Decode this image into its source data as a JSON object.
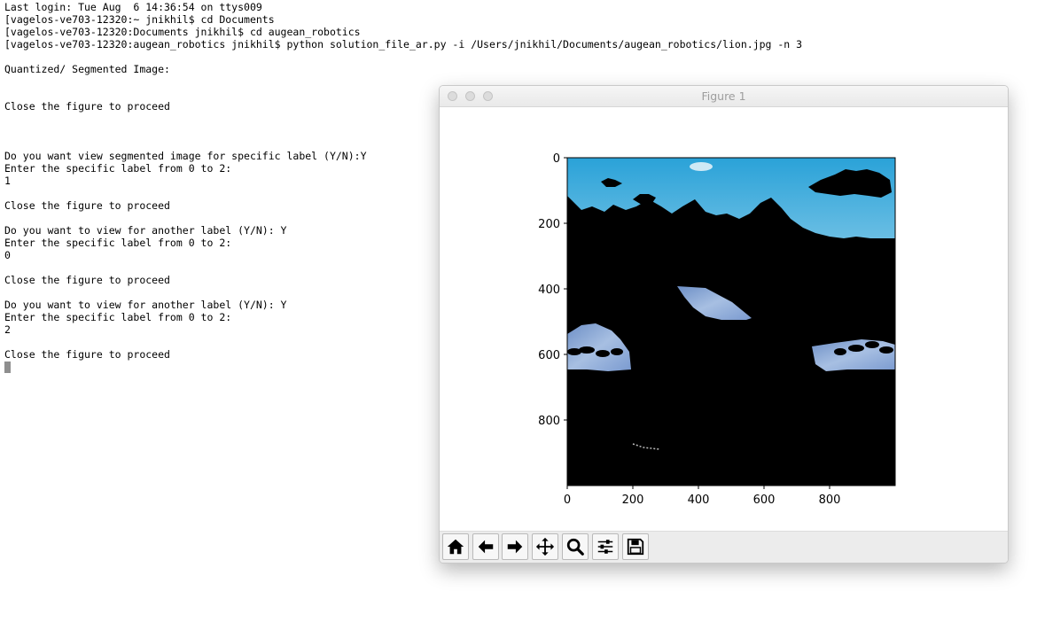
{
  "terminal": {
    "lines": [
      "Last login: Tue Aug  6 14:36:54 on ttys009",
      "[vagelos-ve703-12320:~ jnikhil$ cd Documents",
      "[vagelos-ve703-12320:Documents jnikhil$ cd augean_robotics",
      "[vagelos-ve703-12320:augean_robotics jnikhil$ python solution_file_ar.py -i /Users/jnikhil/Documents/augean_robotics/lion.jpg -n 3",
      "",
      "Quantized/ Segmented Image:",
      "",
      "",
      "Close the figure to proceed",
      "",
      "",
      "",
      "Do you want view segmented image for specific label (Y/N):Y",
      "Enter the specific label from 0 to 2:",
      "1",
      "",
      "Close the figure to proceed",
      "",
      "Do you want to view for another label (Y/N): Y",
      "Enter the specific label from 0 to 2:",
      "0",
      "",
      "Close the figure to proceed",
      "",
      "Do you want to view for another label (Y/N): Y",
      "Enter the specific label from 0 to 2:",
      "2",
      "",
      "Close the figure to proceed"
    ]
  },
  "figure": {
    "window_title": "Figure 1",
    "plot": {
      "x_ticks": [
        "0",
        "200",
        "400",
        "600",
        "800"
      ],
      "y_ticks": [
        "0",
        "200",
        "400",
        "600",
        "800"
      ],
      "xlim": [
        0,
        1000
      ],
      "ylim_inverted": [
        1000,
        0
      ],
      "image_description": "segmented image: label shown in color, rest black",
      "colors": {
        "sky_top": "#2aa2d8",
        "sky_bottom": "#8ccdea",
        "water": "#7f9fcf",
        "mask": "#000000"
      }
    },
    "toolbar": [
      {
        "name": "home-icon",
        "label": "Home"
      },
      {
        "name": "back-arrow-icon",
        "label": "Back"
      },
      {
        "name": "forward-arrow-icon",
        "label": "Forward"
      },
      {
        "name": "pan-icon",
        "label": "Pan"
      },
      {
        "name": "zoom-icon",
        "label": "Zoom"
      },
      {
        "name": "configure-subplots-icon",
        "label": "Configure subplots"
      },
      {
        "name": "save-icon",
        "label": "Save"
      }
    ]
  }
}
